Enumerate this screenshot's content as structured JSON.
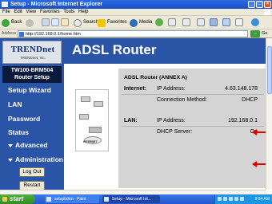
{
  "window": {
    "title": "Setup - Microsoft Internet Explorer",
    "menu": [
      "File",
      "Edit",
      "View",
      "Favorites",
      "Tools",
      "Help"
    ]
  },
  "toolbar": {
    "back_label": "Back",
    "search_label": "Search",
    "favorites_label": "Favorites",
    "media_label": "Media"
  },
  "address": {
    "label": "Address",
    "url": "http://192.168.0.1/home.htm",
    "go_label": "Go"
  },
  "sidebar": {
    "logo": "TRENDnet",
    "logo_sub": "TRENDnet, Inc.",
    "model": "TW100-BRM504",
    "model_sub": "Router Setup",
    "nav": [
      {
        "label": "Setup Wizard"
      },
      {
        "label": "LAN"
      },
      {
        "label": "Password"
      },
      {
        "label": "Status"
      },
      {
        "label": "Advanced"
      },
      {
        "label": "Administration"
      }
    ],
    "logout_label": "Log Out",
    "restart_label": "Restart"
  },
  "banner": {
    "title": "ADSL Router"
  },
  "device_image": {
    "label": "INTERNET"
  },
  "info": {
    "title": "ADSL Router (ANNEX A)",
    "internet_label": "Internet:",
    "ip_label": "IP Address:",
    "ip_value": "4.63.148.178",
    "conn_label": "Connection Method:",
    "conn_value": "DHCP",
    "lan_label": "LAN:",
    "lan_ip_label": "IP Address:",
    "lan_ip_value": "192.168.0.1",
    "dhcp_label": "DHCP Server:",
    "dhcp_value": "On"
  },
  "taskbar": {
    "start_label": "start",
    "tasks": [
      {
        "label": "setupbdrm - Paint"
      },
      {
        "label": "Setup - Microsoft Int..."
      }
    ],
    "clock": "9:54 AM"
  },
  "colors": {
    "banner_blue": "#2a55a6",
    "panel_gray": "#d4d4d4",
    "arrow_red": "#e00000",
    "xp_title_blue": "#1a4fc8"
  }
}
